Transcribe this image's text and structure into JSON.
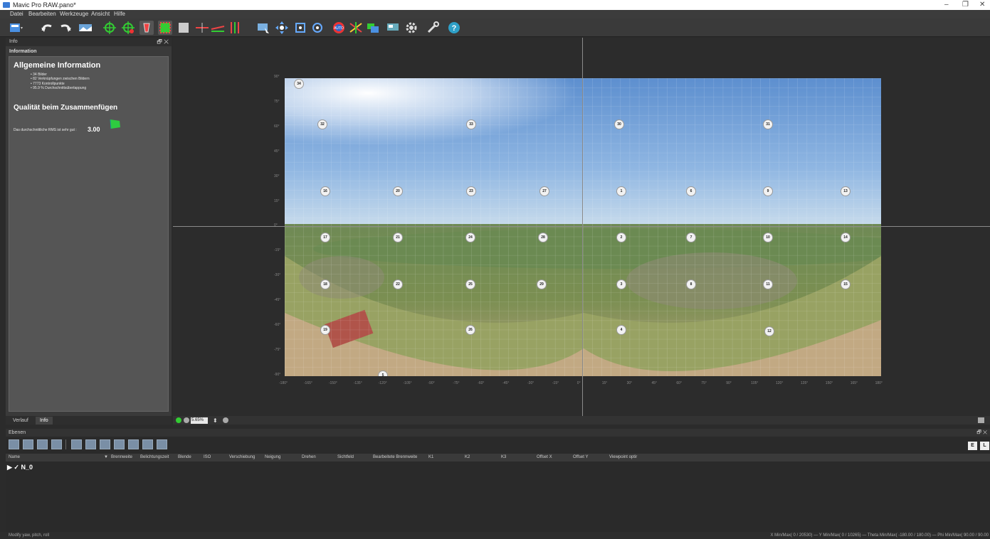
{
  "window": {
    "title": "Mavic Pro RAW.pano*",
    "controls": {
      "minimize": "–",
      "restore": "❐",
      "close": "✕"
    }
  },
  "menu": [
    "Datei",
    "Bearbeiten",
    "Werkzeuge",
    "Ansicht",
    "Hilfe"
  ],
  "toolbar": {
    "icons": [
      "project-menu",
      "undo",
      "redo",
      "panorama-editor",
      "add-control-points",
      "clean-control-points",
      "mask",
      "crop",
      "straighten",
      "horizon",
      "vertical-lines",
      "select-images",
      "move-image",
      "fit-panorama",
      "center-panorama",
      "auto-align",
      "optimizer",
      "color-correction",
      "blend",
      "render",
      "settings",
      "tools",
      "help"
    ]
  },
  "left_panel": {
    "header": "Info",
    "header_controls": "🗗 ✕",
    "subheader": "Information",
    "general_title": "Allgemeine Information",
    "stats": [
      "• 34 Bilder",
      "• 82 Verknüpfungen zwischen Bildern",
      "• 7773 Kontrollpunkte",
      "• 95.9 % Durchschnittsüberlappung"
    ],
    "quality_title": "Qualität beim Zusammenfügen",
    "rms_text": "Das durchschnittliche RMS ist sehr gut :",
    "rms_value": "3.00",
    "flag_color": "#2ecc40",
    "tabs": [
      "Verlauf",
      "Info"
    ],
    "active_tab": "Info"
  },
  "viewport": {
    "markers": [
      "34",
      "32",
      "33",
      "30",
      "31",
      "16",
      "20",
      "23",
      "27",
      "1",
      "6",
      "9",
      "13",
      "17",
      "21",
      "24",
      "28",
      "2",
      "7",
      "10",
      "14",
      "18",
      "22",
      "25",
      "29",
      "3",
      "8",
      "11",
      "15",
      "19",
      "26",
      "4",
      "12",
      "5"
    ],
    "y_ticks": [
      "90°",
      "75°",
      "60°",
      "45°",
      "30°",
      "15°",
      "0°",
      "-15°",
      "-30°",
      "-45°",
      "-60°",
      "-75°",
      "-90°"
    ],
    "x_ticks": [
      "-180°",
      "-165°",
      "-150°",
      "-135°",
      "-120°",
      "-105°",
      "-90°",
      "-75°",
      "-60°",
      "-45°",
      "-30°",
      "-15°",
      "0°",
      "15°",
      "30°",
      "45°",
      "60°",
      "75°",
      "90°",
      "105°",
      "120°",
      "135°",
      "150°",
      "165°",
      "180°"
    ]
  },
  "zoom": {
    "value": "5.65%"
  },
  "layers": {
    "title": "Ebenen",
    "header_controls": "🗗 ✕",
    "columns": [
      "Name",
      "Brennweite",
      "Belichtungszeit",
      "Blende",
      "ISO",
      "Verschiebung",
      "Neigung",
      "Drehen",
      "Sichtfeld",
      "Bearbeitete Brennweite",
      "K1",
      "K2",
      "K3",
      "Offset X",
      "Offset Y",
      "Viewpoint optir"
    ],
    "rows": [
      {
        "name": "▶ ✓ N_0"
      }
    ],
    "right_buttons": [
      "E",
      "L"
    ]
  },
  "status": {
    "left": "Modify yaw, pitch, roll",
    "right": "X Min/Max( 0 / 20530)  —  Y Min/Max( 0 / 10265)  —  Theta Min/Max( -180.00 / 180.00)  —  Phi Min/Max( 90.00 / 90.00"
  }
}
